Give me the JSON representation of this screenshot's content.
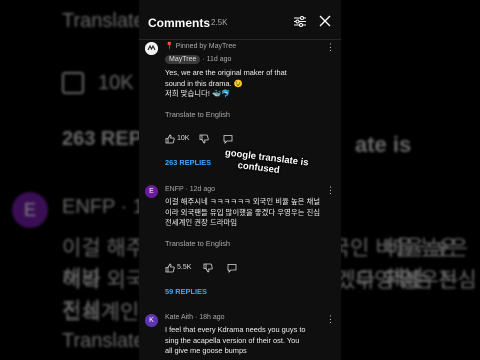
{
  "background": {
    "translate_top": "Translate to English",
    "like_count": "10K",
    "replies": "263 REPLIES",
    "avatar_letter": "E",
    "enfp_meta": "ENFP · 12d ago",
    "line1": "이걸 해주시네 ㅋㅋㅋㅋㅋㅋ 외국인 비율 높은 채널",
    "line2": "이라 외국팬들 유입 많이했을 좋겠다 우영우는 진심",
    "line3": "전세계인 권장 드라마임",
    "translate_bottom": "Translate to English",
    "right1": "ate is",
    "right2": "비율 높은 채널",
    "right3": "우영우는 진심"
  },
  "header": {
    "title": "Comments",
    "count": "2.5K"
  },
  "comments": [
    {
      "pinned_by": "Pinned by MayTree",
      "author": "MayTree",
      "time": "· 11d ago",
      "line1": "Yes, we are the original maker of that",
      "line2": "sound in this drama. 😉",
      "line3": "저희 맞습니다! 🐳🐬",
      "translate": "Translate to English",
      "likes": "10K",
      "replies": "263 REPLIES"
    },
    {
      "avatar_letter": "E",
      "meta": "ENFP · 12d ago",
      "line1": "이걸 해주시네 ㅋㅋㅋㅋㅋㅋ 외국인 비율 높은 채널",
      "line2": "이라 외국팬들 유입 많이했을 좋겠다 우영우는 진심",
      "line3": "전세계인 권장 드라마임",
      "translate": "Translate to English",
      "likes": "5.5K",
      "replies": "59 REPLIES"
    },
    {
      "avatar_letter": "K",
      "meta": "Kate Aith · 18h ago",
      "line1": "I feel that every Kdrama needs you guys to",
      "line2": "sing the acapella version of their ost. You",
      "line3": "all give me goose bumps"
    }
  ],
  "overlay": {
    "line1": "google translate is",
    "line2": "confused"
  },
  "colors": {
    "panel_bg": "#0f0f0f",
    "link_blue": "#3ea6ff",
    "avatar_purple": "#6a1b9a"
  },
  "icons": [
    "filter-icon",
    "close-icon",
    "pin-icon",
    "thumbs-up-icon",
    "thumbs-down-icon",
    "reply-icon",
    "more-vert-icon"
  ]
}
